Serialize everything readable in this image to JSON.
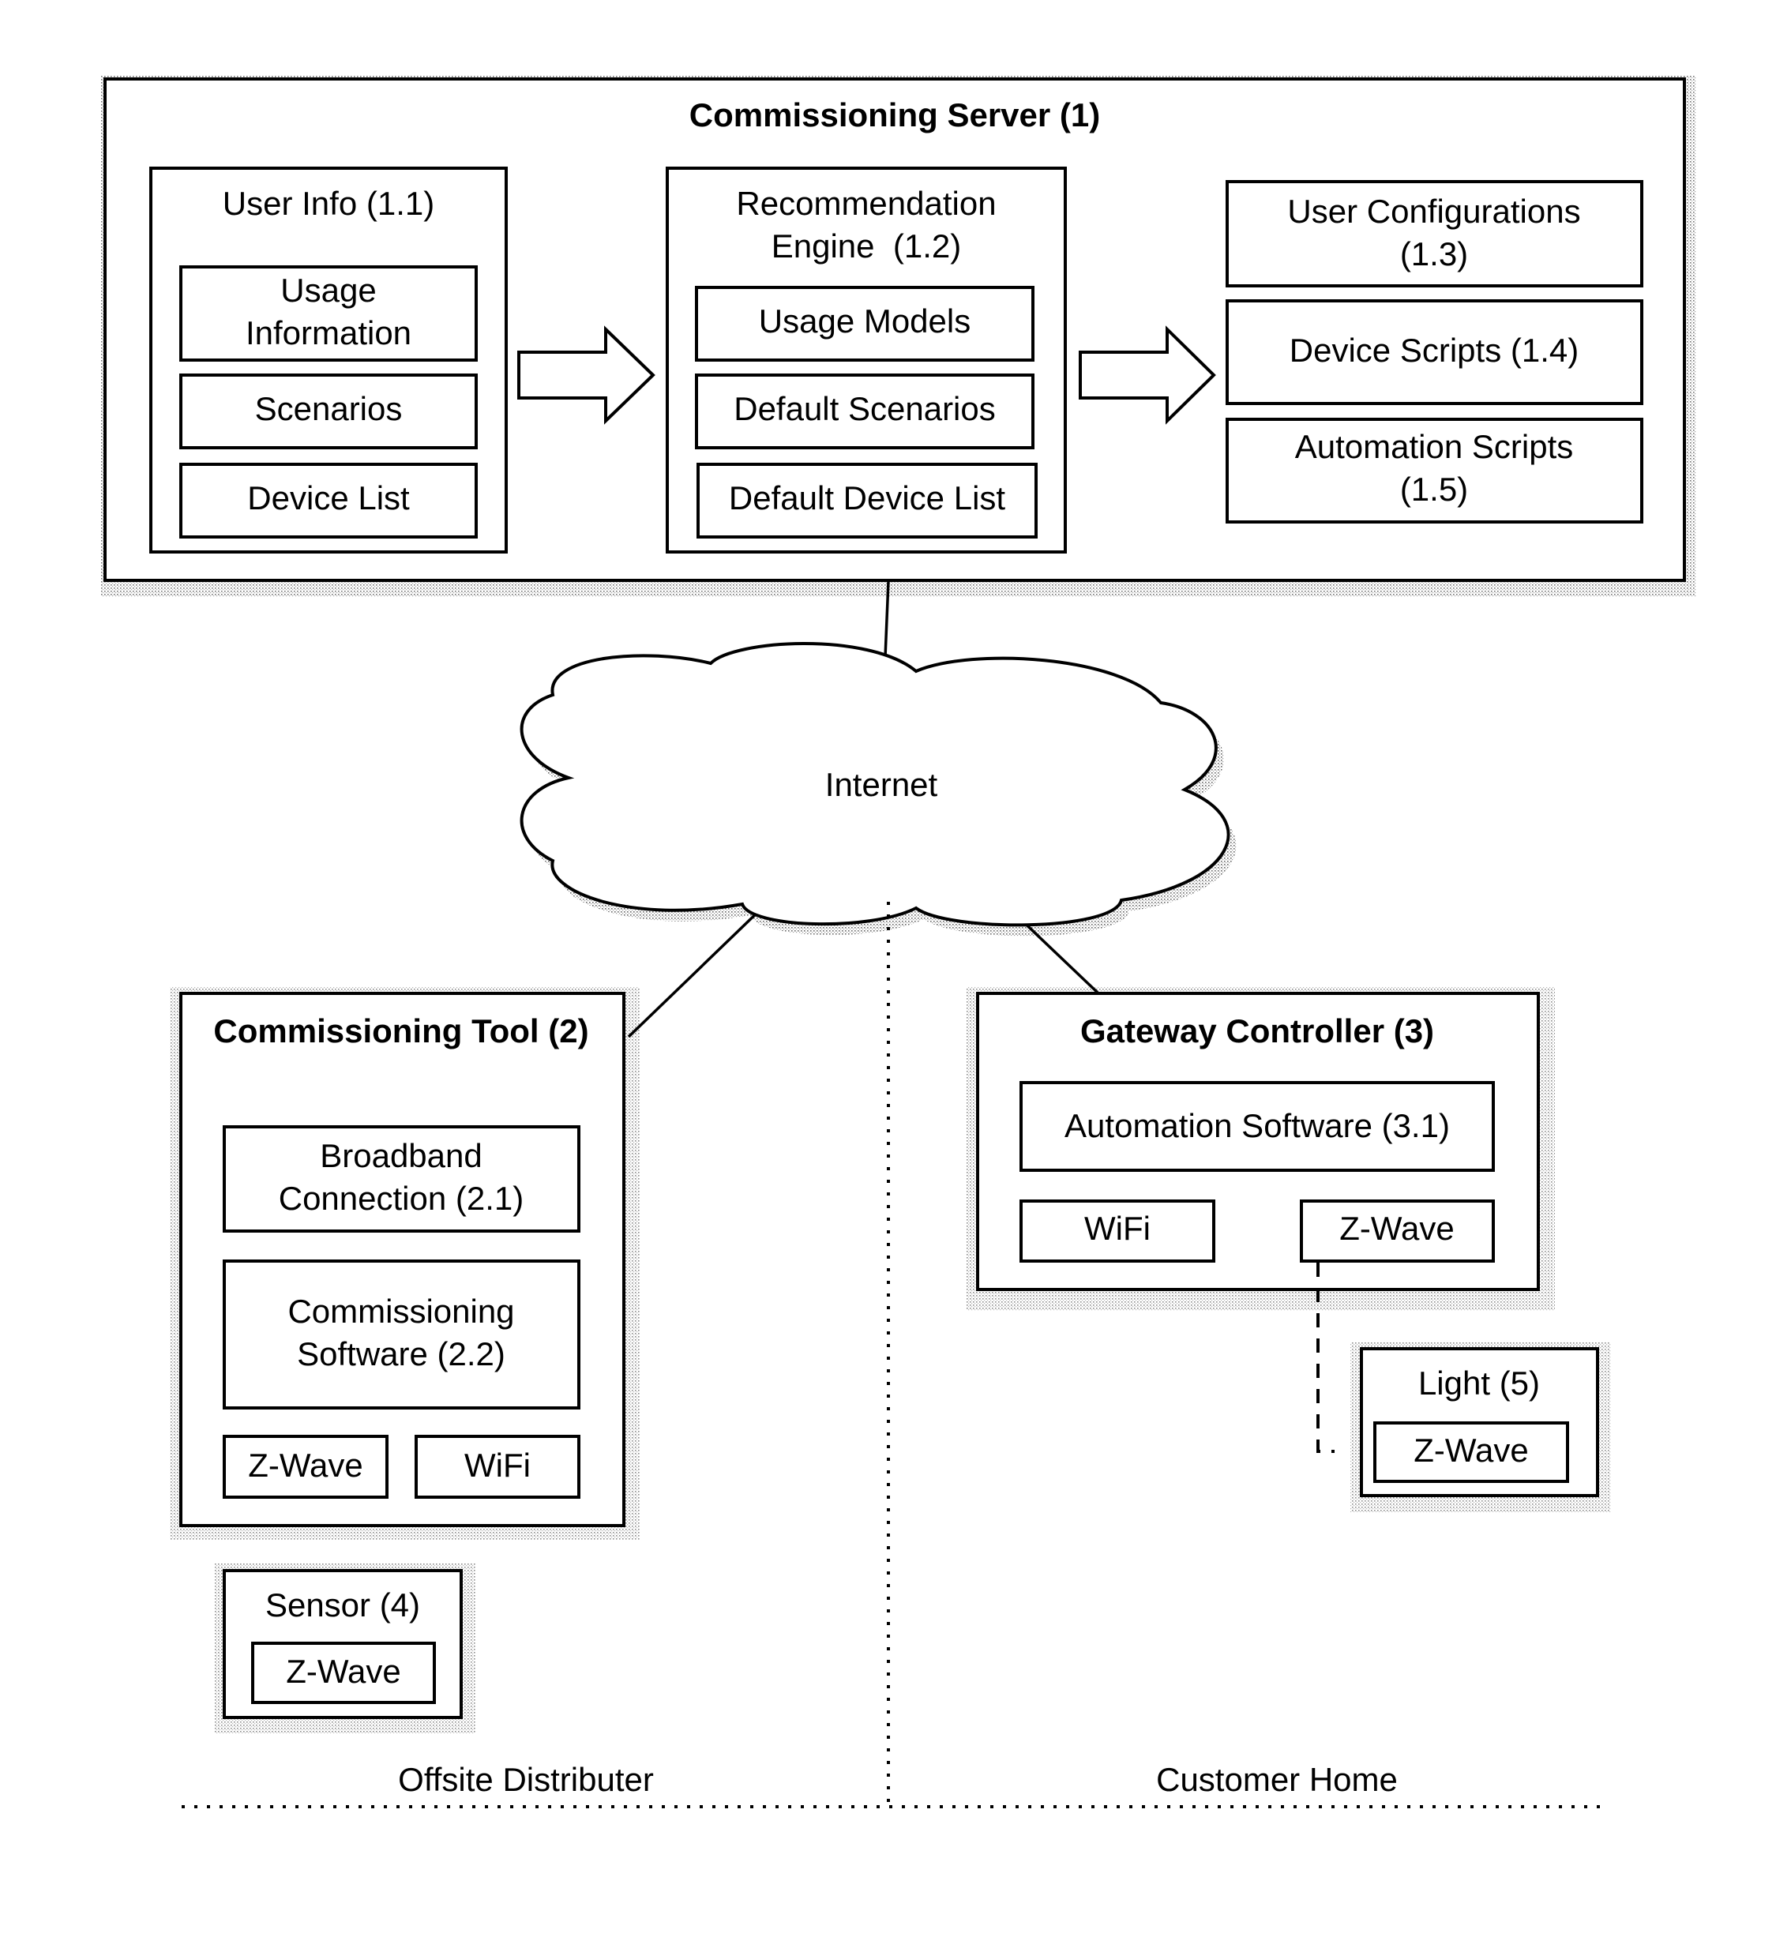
{
  "server": {
    "title": "Commissioning Server (1)",
    "user_info": {
      "title": "User Info (1.1)",
      "items": [
        {
          "line1": "Usage",
          "line2": "Information"
        },
        {
          "line1": "Scenarios"
        },
        {
          "line1": "Device List"
        }
      ]
    },
    "recommendation_engine": {
      "title_line1": "Recommendation",
      "title_line2": "Engine  (1.2)",
      "items": [
        "Usage Models",
        "Default Scenarios",
        "Default Device List"
      ]
    },
    "outputs": [
      {
        "line1": "User Configurations",
        "line2": "(1.3)"
      },
      {
        "line1": "Device Scripts (1.4)"
      },
      {
        "line1": "Automation Scripts",
        "line2": "(1.5)"
      }
    ]
  },
  "network": {
    "cloud_label": "Internet"
  },
  "commissioning_tool": {
    "title": "Commissioning Tool (2)",
    "broadband": {
      "line1": "Broadband",
      "line2": "Connection (2.1)"
    },
    "software": {
      "line1": "Commissioning",
      "line2": "Software (2.2)"
    },
    "zwave": "Z-Wave",
    "wifi": "WiFi"
  },
  "sensor": {
    "title": "Sensor (4)",
    "zwave": "Z-Wave"
  },
  "gateway_controller": {
    "title": "Gateway Controller (3)",
    "automation_software": "Automation Software (3.1)",
    "wifi": "WiFi",
    "zwave": "Z-Wave"
  },
  "light": {
    "title": "Light (5)",
    "zwave": "Z-Wave"
  },
  "zones": {
    "left": "Offsite Distributer",
    "right": "Customer Home"
  }
}
